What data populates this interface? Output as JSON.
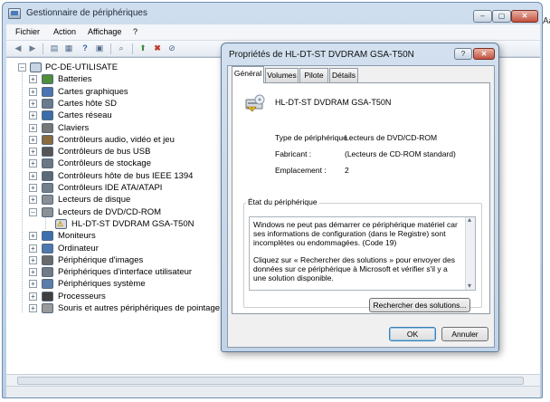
{
  "main_window": {
    "title": "Gestionnaire de périphériques",
    "caption_buttons": {
      "minimize": "–",
      "maximize": "▢",
      "close": "✕"
    },
    "menu": [
      "Fichier",
      "Action",
      "Affichage",
      "?"
    ],
    "toolbar_icons": [
      "back-arrow-icon",
      "forward-arrow-icon",
      "up-folder-icon",
      "properties-icon",
      "help-icon",
      "show-hidden-icon",
      "scan-hardware-icon",
      "update-driver-icon",
      "uninstall-icon",
      "disable-device-icon"
    ]
  },
  "tree": {
    "root": "PC-DE-UTILISATE",
    "categories": [
      {
        "label": "Batteries",
        "icon": "battery-icon",
        "color": "#4f8f3a"
      },
      {
        "label": "Cartes graphiques",
        "icon": "display-adapter-icon",
        "color": "#4a74b2"
      },
      {
        "label": "Cartes hôte SD",
        "icon": "sd-host-icon",
        "color": "#6a7b8c"
      },
      {
        "label": "Cartes réseau",
        "icon": "network-adapter-icon",
        "color": "#3b6ea8"
      },
      {
        "label": "Claviers",
        "icon": "keyboard-icon",
        "color": "#777777"
      },
      {
        "label": "Contrôleurs audio, vidéo et jeu",
        "icon": "speaker-icon",
        "color": "#8a6b3d"
      },
      {
        "label": "Contrôleurs de bus USB",
        "icon": "usb-icon",
        "color": "#555555"
      },
      {
        "label": "Contrôleurs de stockage",
        "icon": "storage-controller-icon",
        "color": "#6c7782"
      },
      {
        "label": "Contrôleurs hôte de bus IEEE 1394",
        "icon": "ieee1394-icon",
        "color": "#5b6875"
      },
      {
        "label": "Contrôleurs IDE ATA/ATAPI",
        "icon": "ide-controller-icon",
        "color": "#737f8b"
      },
      {
        "label": "Lecteurs de disque",
        "icon": "disk-drive-icon",
        "color": "#8a8f94"
      },
      {
        "label": "Lecteurs de DVD/CD-ROM",
        "icon": "dvd-drive-icon",
        "color": "#8c9197",
        "expanded": true
      },
      {
        "label": "Moniteurs",
        "icon": "monitor-icon",
        "color": "#3d6fae"
      },
      {
        "label": "Ordinateur",
        "icon": "computer-icon",
        "color": "#4d78ad"
      },
      {
        "label": "Périphérique d'images",
        "icon": "camera-icon",
        "color": "#6a6a6a"
      },
      {
        "label": "Périphériques d'interface utilisateur",
        "icon": "hid-icon",
        "color": "#707b86"
      },
      {
        "label": "Périphériques système",
        "icon": "system-device-icon",
        "color": "#5a7ea9"
      },
      {
        "label": "Processeurs",
        "icon": "processor-icon",
        "color": "#3f3f3f"
      },
      {
        "label": "Souris et autres périphériques de pointage",
        "icon": "mouse-icon",
        "color": "#9a9a9a"
      }
    ],
    "child_device": "HL-DT-ST DVDRAM GSA-T50N"
  },
  "dialog": {
    "title": "Propriétés de HL-DT-ST DVDRAM GSA-T50N",
    "help_button": "?",
    "close_button": "✕",
    "tabs": [
      "Général",
      "Volumes",
      "Pilote",
      "Détails"
    ],
    "device_name": "HL-DT-ST DVDRAM GSA-T50N",
    "properties": [
      {
        "label": "Type de périphérique :",
        "value": "Lecteurs de DVD/CD-ROM"
      },
      {
        "label": "Fabricant :",
        "value": "(Lecteurs de CD-ROM standard)"
      },
      {
        "label": "Emplacement :",
        "value": "2"
      }
    ],
    "status_group_title": "État du périphérique",
    "status_text_1": "Windows ne peut pas démarrer ce périphérique matériel car ses informations de configuration (dans le Registre) sont incomplètes ou endommagées. (Code 19)",
    "status_text_2": "Cliquez sur « Rechercher des solutions » pour envoyer des données sur ce périphérique à Microsoft et vérifier s'il y a une solution disponible.",
    "find_solutions_button": "Rechercher des solutions...",
    "ok_button": "OK",
    "cancel_button": "Annuler"
  },
  "background_fragment": "Aa"
}
